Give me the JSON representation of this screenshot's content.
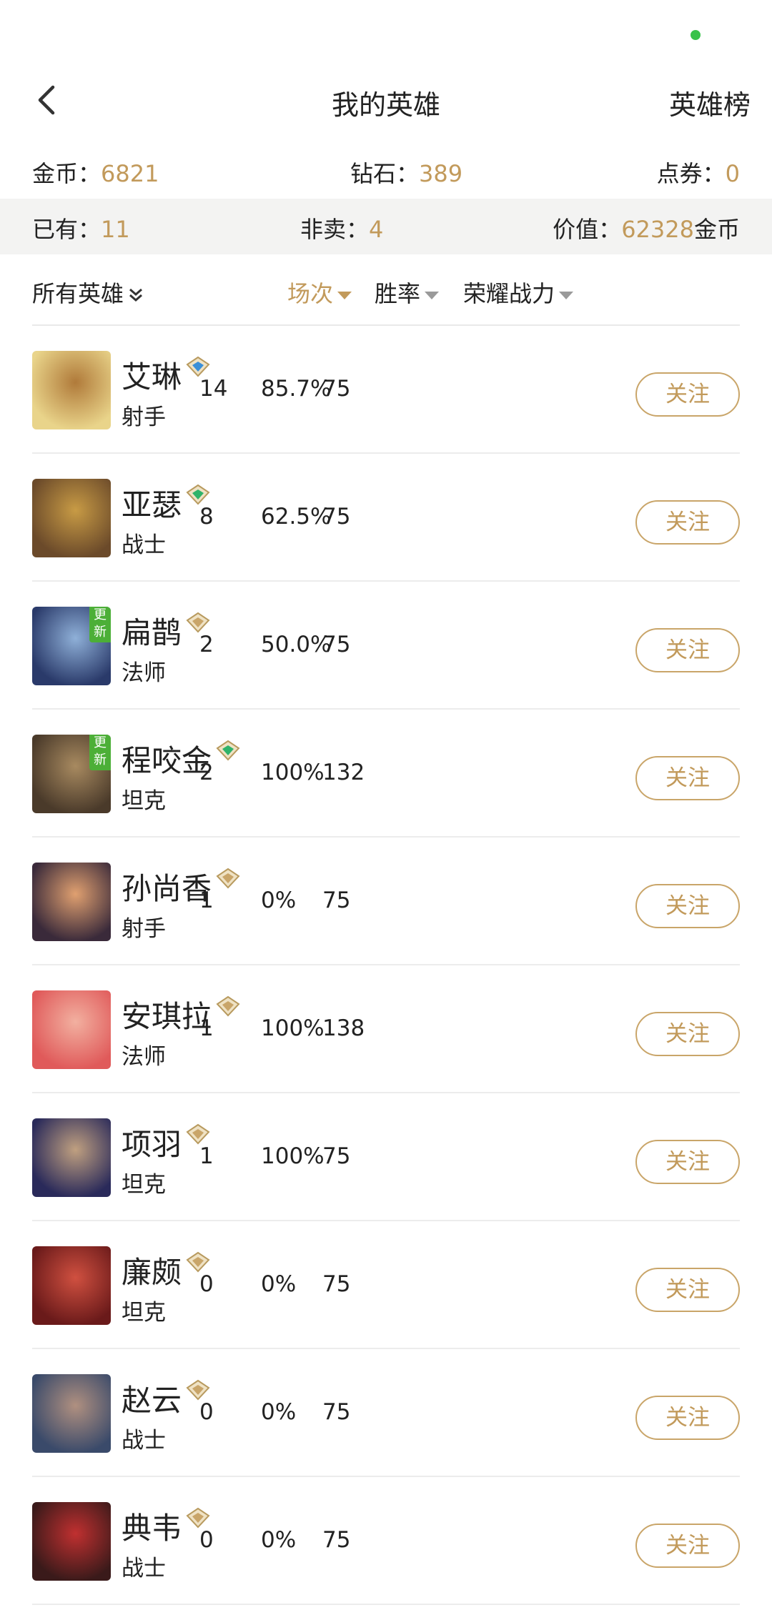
{
  "navbar": {
    "title": "我的英雄",
    "rank_link": "英雄榜"
  },
  "currency": {
    "gold_label": "金币：",
    "gold_value": "6821",
    "diamond_label": "钻石：",
    "diamond_value": "389",
    "voucher_label": "点券：",
    "voucher_value": "0"
  },
  "owned": {
    "have_label": "已有：",
    "have_value": "11",
    "notsale_label": "非卖：",
    "notsale_value": "4",
    "value_label": "价值：",
    "value_value": "62328",
    "value_unit": "金币"
  },
  "sort": {
    "filter_label": "所有英雄",
    "games_label": "场次",
    "winrate_label": "胜率",
    "power_label": "荣耀战力"
  },
  "follow_label": "关注",
  "new_badge": "更新",
  "colors": {
    "accent": "#c29a5b",
    "text": "#222222",
    "new_badge": "#4caf37"
  },
  "heroes": [
    {
      "name": "艾琳",
      "role": "射手",
      "games": "14",
      "winrate": "85.7%",
      "power": "75",
      "new": false,
      "rank_icon": "rank-blue-icon"
    },
    {
      "name": "亚瑟",
      "role": "战士",
      "games": "8",
      "winrate": "62.5%",
      "power": "75",
      "new": false,
      "rank_icon": "rank-green-icon"
    },
    {
      "name": "扁鹊",
      "role": "法师",
      "games": "2",
      "winrate": "50.0%",
      "power": "75",
      "new": true,
      "rank_icon": "rank-bronze-icon"
    },
    {
      "name": "程咬金",
      "role": "坦克",
      "games": "2",
      "winrate": "100%",
      "power": "132",
      "new": true,
      "rank_icon": "rank-green-icon"
    },
    {
      "name": "孙尚香",
      "role": "射手",
      "games": "1",
      "winrate": "0%",
      "power": "75",
      "new": false,
      "rank_icon": "rank-bronze-icon"
    },
    {
      "name": "安琪拉",
      "role": "法师",
      "games": "1",
      "winrate": "100%",
      "power": "138",
      "new": false,
      "rank_icon": "rank-bronze-icon"
    },
    {
      "name": "项羽",
      "role": "坦克",
      "games": "1",
      "winrate": "100%",
      "power": "75",
      "new": false,
      "rank_icon": "rank-bronze-icon"
    },
    {
      "name": "廉颇",
      "role": "坦克",
      "games": "0",
      "winrate": "0%",
      "power": "75",
      "new": false,
      "rank_icon": "rank-bronze-icon"
    },
    {
      "name": "赵云",
      "role": "战士",
      "games": "0",
      "winrate": "0%",
      "power": "75",
      "new": false,
      "rank_icon": "rank-bronze-icon"
    },
    {
      "name": "典韦",
      "role": "战士",
      "games": "0",
      "winrate": "0%",
      "power": "75",
      "new": false,
      "rank_icon": "rank-bronze-icon"
    }
  ]
}
